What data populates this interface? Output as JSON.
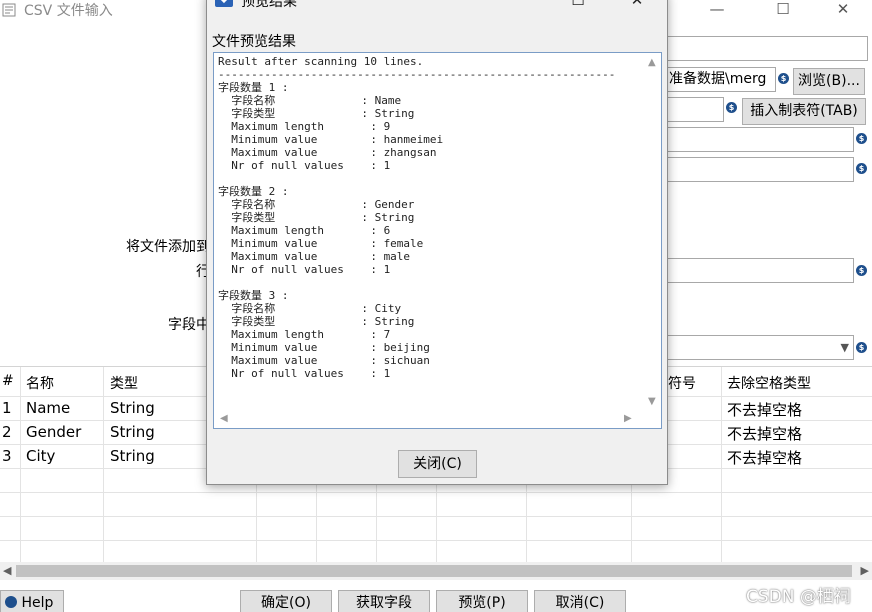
{
  "window": {
    "title": "CSV 文件输入",
    "minimize": "—",
    "maximize": "☐",
    "close": "✕"
  },
  "form": {
    "filename_value": "",
    "path_value": "准备数据\\merg",
    "browse_label": "浏览(B)...",
    "insert_tab_label": "插入制表符(TAB)",
    "label_add_filename": "将文件添加到",
    "label_row": "行",
    "label_field": "字段中",
    "var_icon": "$"
  },
  "table": {
    "columns": [
      "#",
      "名称",
      "类型",
      "符号",
      "去除空格类型"
    ],
    "rows": [
      {
        "num": "1",
        "name": "Name",
        "type": "String",
        "trim": "不去掉空格"
      },
      {
        "num": "2",
        "name": "Gender",
        "type": "String",
        "trim": "不去掉空格"
      },
      {
        "num": "3",
        "name": "City",
        "type": "String",
        "trim": "不去掉空格"
      }
    ]
  },
  "bottom_buttons": {
    "help": "Help",
    "ok": "确定(O)",
    "get_fields": "获取字段",
    "preview": "预览(P)",
    "cancel": "取消(C)"
  },
  "dialog": {
    "title": "预览结果",
    "subtitle": "文件预览结果",
    "minimize": "—",
    "maximize": "☐",
    "close": "✕",
    "close_button": "关闭(C)",
    "content": "Result after scanning 10 lines.\n------------------------------------------------------------\n字段数量 1 :\n  字段名称             : Name\n  字段类型             : String\n  Maximum length       : 9\n  Minimum value        : hanmeimei\n  Maximum value        : zhangsan\n  Nr of null values    : 1\n\n字段数量 2 :\n  字段名称             : Gender\n  字段类型             : String\n  Maximum length       : 6\n  Minimum value        : female\n  Maximum value        : male\n  Nr of null values    : 1\n\n字段数量 3 :\n  字段名称             : City\n  字段类型             : String\n  Maximum length       : 7\n  Minimum value        : beijing\n  Maximum value        : sichuan\n  Nr of null values    : 1"
  },
  "watermark": "CSDN @栖祠"
}
